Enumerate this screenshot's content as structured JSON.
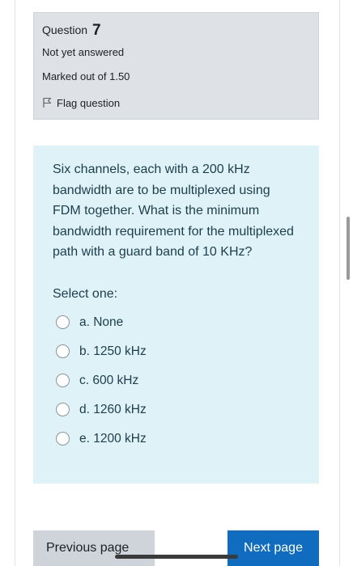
{
  "info": {
    "question_label": "Question",
    "question_number": "7",
    "status": "Not yet answered",
    "marks": "Marked out of 1.50",
    "flag_label": "Flag question"
  },
  "question": {
    "text": "Six channels, each with a 200 kHz bandwidth are to be multiplexed using FDM together. What is the minimum bandwidth requirement for the multiplexed path with a guard band of 10 KHz?",
    "prompt": "Select one:",
    "options": [
      {
        "label": "a. None"
      },
      {
        "label": "b. 1250 kHz"
      },
      {
        "label": "c. 600 kHz"
      },
      {
        "label": "d. 1260 kHz"
      },
      {
        "label": "e. 1200 kHz"
      }
    ]
  },
  "nav": {
    "previous_label": "Previous page",
    "next_label": "Next page"
  },
  "colors": {
    "info_bg": "#dee2e6",
    "content_bg": "#def2f8",
    "primary": "#0f6cbf",
    "secondary": "#ced4da"
  },
  "icons": {
    "flag": "flag-outline-icon",
    "radio": "radio-unchecked-icon"
  }
}
